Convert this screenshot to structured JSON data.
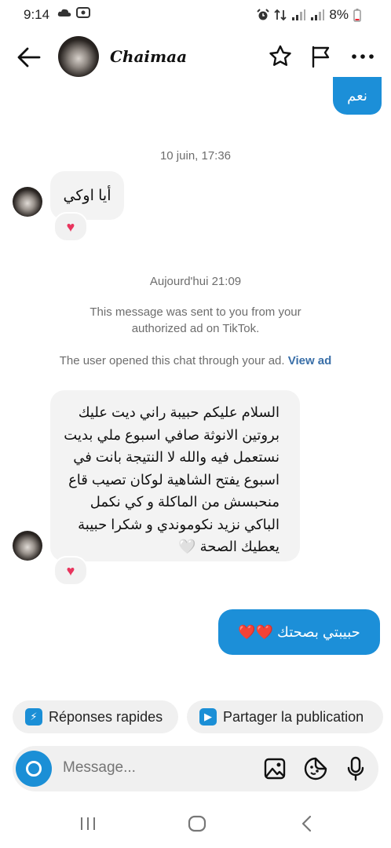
{
  "status": {
    "time": "9:14",
    "battery": "8%"
  },
  "header": {
    "contact_name": "Chaimaa"
  },
  "messages": {
    "top_sent": "نعم",
    "date1": "10 juin, 17:36",
    "recv1": "أيا اوكي",
    "recv1_reaction": "♥",
    "date2": "Aujourd'hui 21:09",
    "ad_notice": "This message was sent to you from your authorized ad on TikTok.",
    "opened_notice": "The user opened this chat through your ad.",
    "opened_link": "View ad",
    "recv2": "السلام عليكم حبيبة راني ديت عليك بروتين الانوثة صافي اسبوع ملي بديت نستعمل فيه والله لا النتيجة بانت في اسبوع يفتح الشاهية لوكان تصيب قاع منحبسش من الماكلة و كي نكمل الباكي نزيد نكوموندي و شكرا حبيبة يعطيك الصحة 🤍",
    "recv2_reaction": "♥",
    "sent2": "حبيبتي بصحتك ❤️❤️"
  },
  "quick": {
    "replies": "Réponses rapides",
    "share": "Partager la publication"
  },
  "composer": {
    "placeholder": "Message..."
  },
  "colors": {
    "accent": "#1c8fd8",
    "incoming": "#f3f3f3",
    "heart": "#e8345d"
  }
}
